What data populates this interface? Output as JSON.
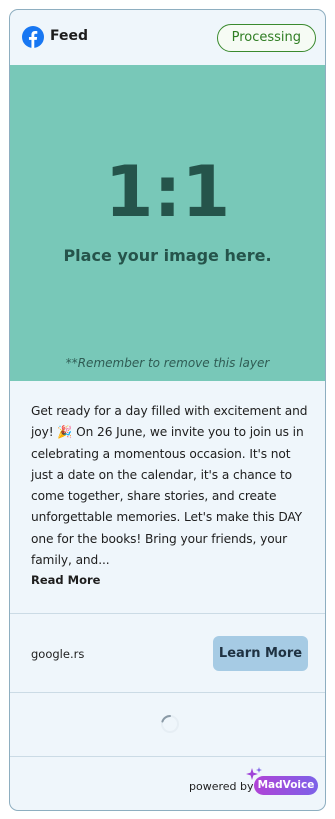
{
  "header": {
    "platform_icon": "facebook-icon",
    "title": "Feed",
    "status": "Processing",
    "status_color": "#2f7d23"
  },
  "media": {
    "aspect_ratio": "1:1",
    "placeholder": "Place your image here.",
    "reminder": "**Remember to remove this layer",
    "background": "#78c8b8"
  },
  "post": {
    "text": "Get ready for a day filled with excitement and joy! 🎉 On 26 June, we invite you to join us in celebrating a momentous occasion. It's not just a date on the calendar, it's a chance to come together, share stories, and create unforgettable memories. Let's make this DAY one for the books! Bring your friends, your family, and...",
    "read_more": "Read More"
  },
  "cta": {
    "domain": "google.rs",
    "button_label": "Learn More",
    "button_color": "#a6cbe4"
  },
  "footer": {
    "powered_by": "powered by",
    "brand": "MadVoice",
    "brand_icon": "sparkle-icon"
  }
}
